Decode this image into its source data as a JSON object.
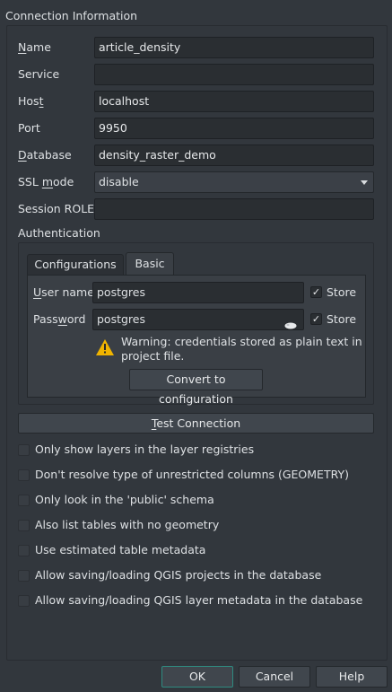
{
  "connection_group": {
    "title": "Connection Information"
  },
  "fields": {
    "name": {
      "label_first": "N",
      "label_rest": "ame",
      "value": "article_density"
    },
    "service": {
      "label": "Service",
      "value": ""
    },
    "host": {
      "label_first": "Hos",
      "label_ul": "t",
      "value": "localhost"
    },
    "port": {
      "label": "Port",
      "value": "9950"
    },
    "database": {
      "label_first": "D",
      "label_rest": "atabase",
      "value": "density_raster_demo"
    },
    "ssl_mode": {
      "label_first": "SSL ",
      "label_ul": "m",
      "label_rest": "ode",
      "value": "disable"
    },
    "session_role": {
      "label": "Session ROLE",
      "value": ""
    }
  },
  "authentication": {
    "title": "Authentication",
    "tabs": [
      "Configurations",
      "Basic"
    ],
    "username_label_first": "U",
    "username_label_rest": "ser name",
    "username_value": "postgres",
    "password_label_first": "Pass",
    "password_label_ul": "w",
    "password_label_rest": "ord",
    "password_value": "postgres",
    "store_label": "Store",
    "store_checked_mark": "✓",
    "warning_line1": "Warning: credentials stored as plain text in",
    "warning_line2": "project file.",
    "convert_button": "Convert to configuration",
    "warning_color": "#f0b400"
  },
  "test_connection": {
    "label_ul": "T",
    "label_rest": "est Connection"
  },
  "options": [
    "Only show layers in the layer registries",
    "Don't resolve type of unrestricted columns (GEOMETRY)",
    "Only look in the 'public' schema",
    "Also list tables with no geometry",
    "Use estimated table metadata",
    "Allow saving/loading QGIS projects in the database",
    "Allow saving/loading QGIS layer metadata in the database"
  ],
  "dialog_buttons": {
    "ok": "OK",
    "cancel": "Cancel",
    "help": "Help"
  },
  "colors": {
    "background": "#32373d",
    "primary_border": "#2f8a80"
  }
}
